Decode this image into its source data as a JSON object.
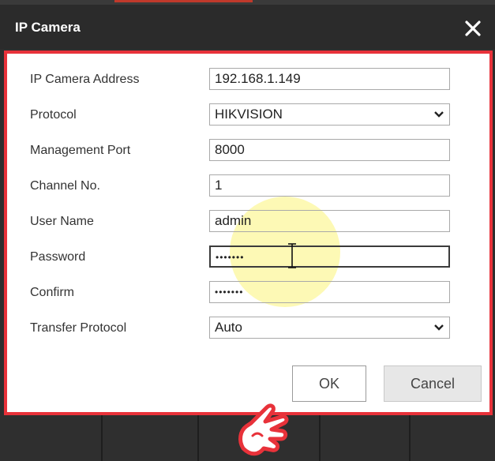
{
  "window": {
    "title": "IP Camera"
  },
  "icons": {
    "close": "close-icon",
    "chevron": "chevron-down-icon",
    "cursor": "text-cursor-icon",
    "pointer": "pointing-hand-icon"
  },
  "form": {
    "ip_address": {
      "label": "IP Camera Address",
      "value": "192.168.1.149"
    },
    "protocol": {
      "label": "Protocol",
      "value": "HIKVISION"
    },
    "management_port": {
      "label": "Management Port",
      "value": "8000"
    },
    "channel_no": {
      "label": "Channel No.",
      "value": "1"
    },
    "user_name": {
      "label": "User Name",
      "value": "admin"
    },
    "password": {
      "label": "Password",
      "value": "•••••••"
    },
    "confirm": {
      "label": "Confirm",
      "value": "•••••••"
    },
    "transfer_protocol": {
      "label": "Transfer Protocol",
      "value": "Auto"
    }
  },
  "buttons": {
    "ok": "OK",
    "cancel": "Cancel"
  },
  "colors": {
    "accent_border": "#e8323a",
    "titlebar": "#2b2b2b",
    "highlight": "#fcf478"
  }
}
